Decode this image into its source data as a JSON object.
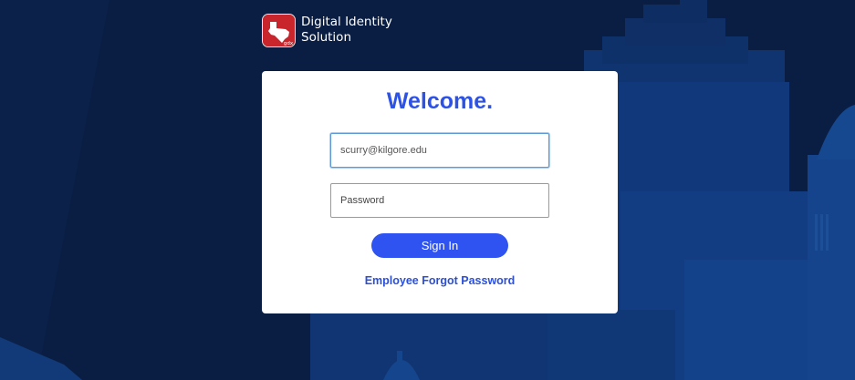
{
  "brand": {
    "line1": "Digital Identity",
    "line2": "Solution",
    "logo_icon": "texas-state-logo-icon",
    "logo_text": "gdx"
  },
  "login": {
    "title": "Welcome.",
    "username_value": "scurry@kilgore.edu",
    "password_placeholder": "Password",
    "sign_in_label": "Sign In",
    "forgot_link": "Employee Forgot Password"
  },
  "colors": {
    "background_dark": "#0a1f45",
    "background_mid": "#123a7a",
    "accent_blue": "#2f53f0",
    "title_blue": "#2d52e6",
    "logo_red": "#c8262c"
  }
}
